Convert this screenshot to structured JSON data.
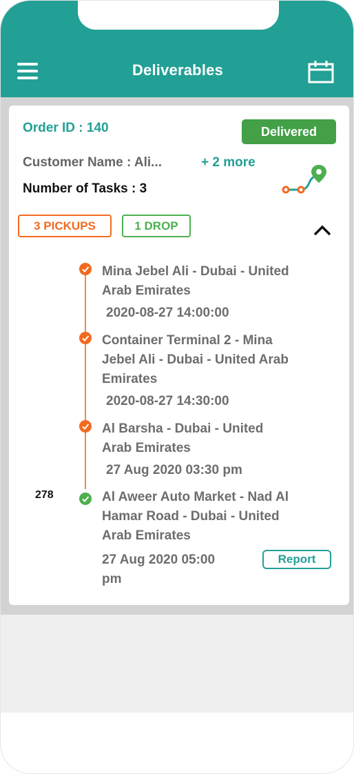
{
  "header": {
    "title": "Deliverables",
    "menu_icon": "hamburger-menu-icon",
    "calendar_icon": "calendar-icon",
    "color": "#22a095"
  },
  "order": {
    "id_label": "Order ID : 140",
    "status": "Delivered",
    "status_color": "#43a047",
    "customer_label": "Customer Name : Ali...",
    "more_label": "+ 2 more",
    "tasks_label": "Number of Tasks : 3",
    "route_icon": "route-map-pin-icon",
    "pickups_tag": "3 PICKUPS",
    "drop_tag": "1 DROP",
    "collapse_icon": "chevron-up-icon"
  },
  "stops": [
    {
      "address_line1": "Mina Jebel Ali - Dubai - United",
      "address_line2": "Arab Emirates",
      "time": "2020-08-27 14:00:00",
      "type": "pickup"
    },
    {
      "address_line1": "Container Terminal 2 - Mina",
      "address_line2": "Jebel Ali - Dubai - United Arab",
      "address_line3": "Emirates",
      "time": "2020-08-27 14:30:00",
      "type": "pickup"
    },
    {
      "address_line1": "Al Barsha - Dubai - United",
      "address_line2": "Arab Emirates",
      "time": "27 Aug 2020 03:30 pm",
      "type": "pickup"
    },
    {
      "number": "278",
      "address_line1": "Al Aweer Auto Market - Nad Al",
      "address_line2": "Hamar Road - Dubai - United",
      "address_line3": "Arab Emirates",
      "time_line1": "27 Aug 2020 05:00",
      "time_line2": "pm",
      "type": "drop",
      "report_label": "Report"
    }
  ],
  "colors": {
    "pickup": "#f26a1f",
    "drop": "#4caf50",
    "accent": "#22a095"
  }
}
